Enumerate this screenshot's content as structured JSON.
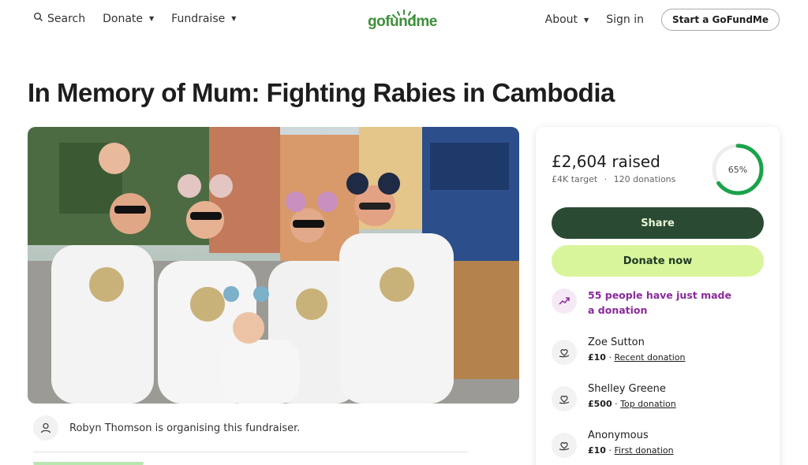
{
  "header": {
    "search_label": "Search",
    "donate_label": "Donate",
    "fundraise_label": "Fundraise",
    "logo_text": "gofundme",
    "about_label": "About",
    "signin_label": "Sign in",
    "start_label": "Start a GoFundMe"
  },
  "campaign": {
    "title": "In Memory of Mum: Fighting Rabies in Cambodia",
    "organiser_text": "Robyn Thomson is organising this fundraiser."
  },
  "stats": {
    "raised": "£2,604 raised",
    "target": "£4K target",
    "separator": "·",
    "donations": "120 donations",
    "percent": "65%",
    "progress_fraction": 0.65
  },
  "actions": {
    "share_label": "Share",
    "donate_label": "Donate now"
  },
  "trending": {
    "text": "55 people have just made a donation"
  },
  "donations": [
    {
      "name": "Zoe Sutton",
      "amount": "£10",
      "sep": "·",
      "tag": "Recent donation"
    },
    {
      "name": "Shelley Greene",
      "amount": "£500",
      "sep": "·",
      "tag": "Top donation"
    },
    {
      "name": "Anonymous",
      "amount": "£10",
      "sep": "·",
      "tag": "First donation"
    }
  ],
  "colors": {
    "brand_green": "#3d8f3a",
    "share_bg": "#2b4a33",
    "donate_bg": "#d9f59c",
    "trend_purple": "#8a2b9a",
    "ring_green": "#1aa34a"
  },
  "icons": {
    "search": "search-icon",
    "avatar": "user-icon",
    "trend": "trending-up-icon",
    "donation": "heart-hand-icon"
  }
}
